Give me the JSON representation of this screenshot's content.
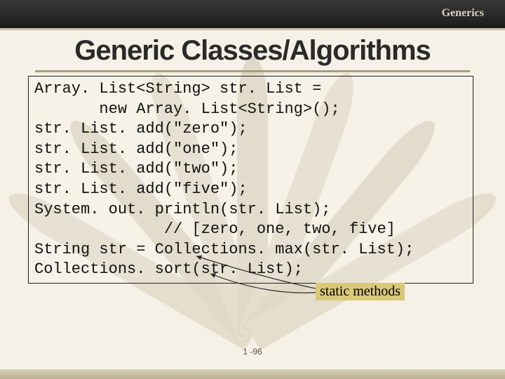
{
  "header": {
    "section_label": "Generics"
  },
  "title": "Generic Classes/Algorithms",
  "code": {
    "line1": "Array. List<String> str. List =",
    "line2": "       new Array. List<String>();",
    "line3": "str. List. add(\"zero\");",
    "line4": "str. List. add(\"one\");",
    "line5": "str. List. add(\"two\");",
    "line6": "str. List. add(\"five\");",
    "line7": "System. out. println(str. List);",
    "line8": "              // [zero, one, two, five]",
    "line9": "String str = Collections. max(str. List);",
    "line10": "Collections. sort(str. List);"
  },
  "callout": {
    "label": "static methods"
  },
  "footer": {
    "slide_number": "1 -96"
  }
}
